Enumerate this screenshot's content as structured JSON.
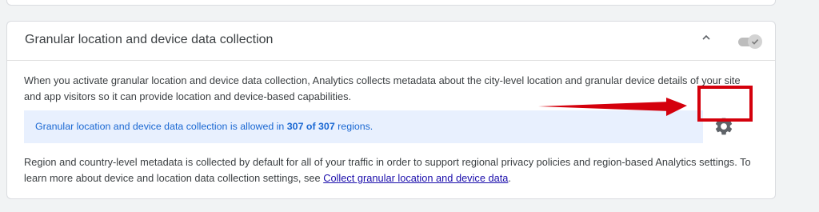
{
  "section": {
    "title": "Granular location and device data collection",
    "toggle_state": "on",
    "description": "When you activate granular location and device data collection, Analytics collects metadata about the city-level location and granular device details of your site and app visitors so it can provide location and device-based capabilities.",
    "banner": {
      "prefix": "Granular location and device data collection is allowed in",
      "count": "307 of 307",
      "suffix": "regions."
    },
    "footer": {
      "text_before": "Region and country-level metadata is collected by default for all of your traffic in order to support regional privacy policies and region-based Analytics settings. To learn more about device and location data collection settings, see",
      "link_text": "Collect granular location and device data",
      "text_after": "."
    }
  },
  "icons": {
    "chevron": "chevron-up-icon",
    "gear": "gear-icon",
    "check": "check-icon"
  },
  "colors": {
    "banner_bg": "#e8f0fe",
    "banner_text": "#1967d2",
    "highlight": "#d4000c",
    "link": "#1a0dab"
  }
}
